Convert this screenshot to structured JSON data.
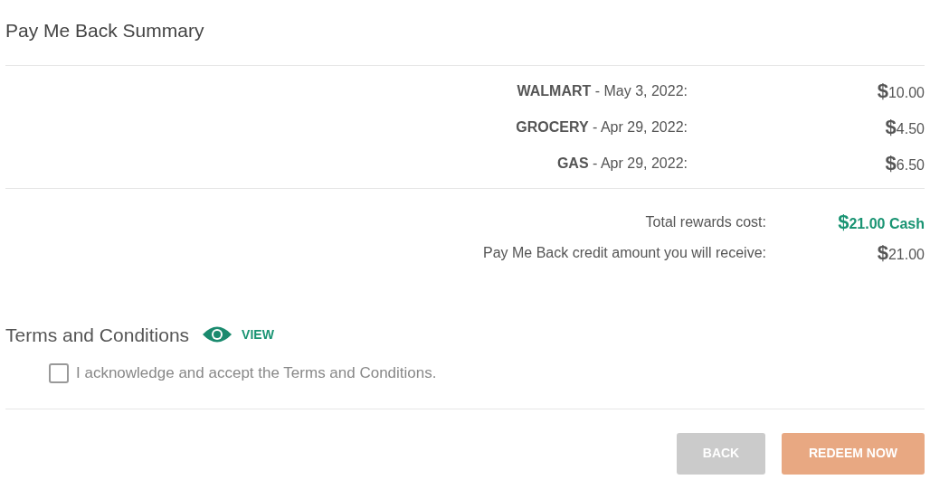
{
  "title": "Pay Me Back Summary",
  "items": [
    {
      "name": "WALMART",
      "date": "- May 3, 2022:",
      "currency": "$",
      "amount": "10.00"
    },
    {
      "name": "GROCERY",
      "date": "- Apr 29, 2022:",
      "currency": "$",
      "amount": "4.50"
    },
    {
      "name": "GAS",
      "date": "- Apr 29, 2022:",
      "currency": "$",
      "amount": "6.50"
    }
  ],
  "totals": [
    {
      "label": "Total rewards cost:",
      "currency": "$",
      "amount": "21.00 Cash",
      "highlight": true
    },
    {
      "label": "Pay Me Back credit amount you will receive:",
      "currency": "$",
      "amount": "21.00",
      "highlight": false
    }
  ],
  "terms": {
    "heading": "Terms and Conditions",
    "view_link": "VIEW",
    "checkbox_label": "I acknowledge and accept the Terms and Conditions.",
    "checked": false
  },
  "buttons": [
    {
      "label": "BACK",
      "kind": "secondary"
    },
    {
      "label": "REDEEM NOW",
      "kind": "primary"
    }
  ]
}
